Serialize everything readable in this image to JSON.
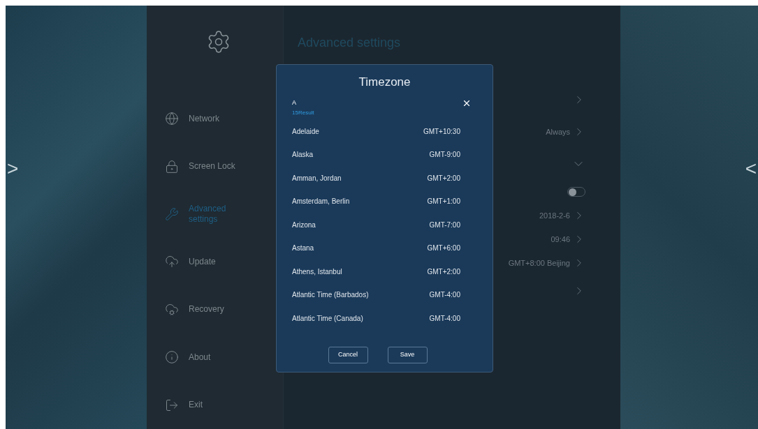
{
  "left_panel": {
    "arrow": ">"
  },
  "right_panel": {
    "arrow": "<"
  },
  "sidebar": {
    "items": [
      {
        "label": "Network",
        "selected": false
      },
      {
        "label": "Screen Lock",
        "selected": false
      },
      {
        "label": "Advanced settings",
        "selected": true
      },
      {
        "label": "Update",
        "selected": false
      },
      {
        "label": "Recovery",
        "selected": false
      },
      {
        "label": "About",
        "selected": false
      },
      {
        "label": "Exit",
        "selected": false
      }
    ]
  },
  "content": {
    "title": "Advanced settings",
    "rows": [
      {
        "kind": "link"
      },
      {
        "kind": "value",
        "value": "Always"
      },
      {
        "kind": "expand",
        "expanded": true
      },
      {
        "kind": "toggle",
        "on": false
      },
      {
        "kind": "value",
        "value": "2018-2-6"
      },
      {
        "kind": "value",
        "value": "09:46"
      },
      {
        "kind": "value",
        "value": "GMT+8:00 Beijing"
      },
      {
        "kind": "link"
      }
    ]
  },
  "dialog": {
    "title": "Timezone",
    "search": {
      "value": "A"
    },
    "result_count": "15Result",
    "zones": [
      {
        "name": "Adelaide",
        "offset": "GMT+10:30"
      },
      {
        "name": "Alaska",
        "offset": "GMT-9:00"
      },
      {
        "name": "Amman, Jordan",
        "offset": "GMT+2:00"
      },
      {
        "name": "Amsterdam, Berlin",
        "offset": "GMT+1:00"
      },
      {
        "name": "Arizona",
        "offset": "GMT-7:00"
      },
      {
        "name": "Astana",
        "offset": "GMT+6:00"
      },
      {
        "name": "Athens, Istanbul",
        "offset": "GMT+2:00"
      },
      {
        "name": "Atlantic Time (Barbados)",
        "offset": "GMT-4:00"
      },
      {
        "name": "Atlantic Time (Canada)",
        "offset": "GMT-4:00"
      }
    ],
    "buttons": [
      "Cancel",
      "Save"
    ]
  }
}
